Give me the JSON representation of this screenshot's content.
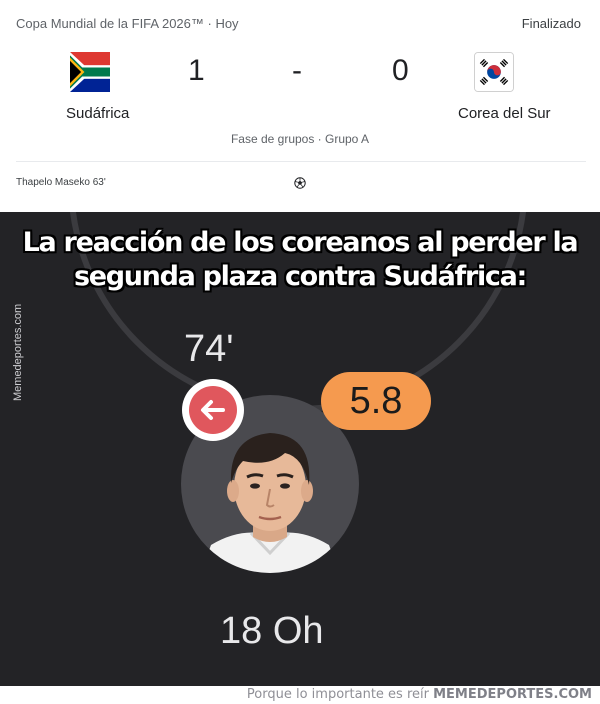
{
  "match": {
    "competition": "Copa Mundial de la FIFA 2026™ · Hoy",
    "status": "Finalizado",
    "home_team": "Sudáfrica",
    "away_team": "Corea del Sur",
    "home_score": "1",
    "separator": "-",
    "away_score": "0",
    "stage": "Fase de grupos · Grupo A",
    "scorer": "Thapelo Maseko 63'"
  },
  "meme": {
    "caption_line1": "La reacción de los coreanos al perder la",
    "caption_line2": "segunda plaza contra Sudáfrica:",
    "watermark": "Memedeportes.com"
  },
  "player_card": {
    "minute": "74'",
    "rating": "5.8",
    "name": "18 Oh",
    "rating_color": "#f59a4f",
    "sub_icon_color": "#e0575d"
  },
  "footer": {
    "tagline": "Porque lo importante es reír",
    "brand": "MEMEDEPORTES.COM"
  },
  "icons": {
    "home_flag": "south-africa-flag-icon",
    "away_flag": "south-korea-flag-icon",
    "ball": "soccer-ball-icon",
    "substitution": "substitution-out-arrow-icon"
  }
}
